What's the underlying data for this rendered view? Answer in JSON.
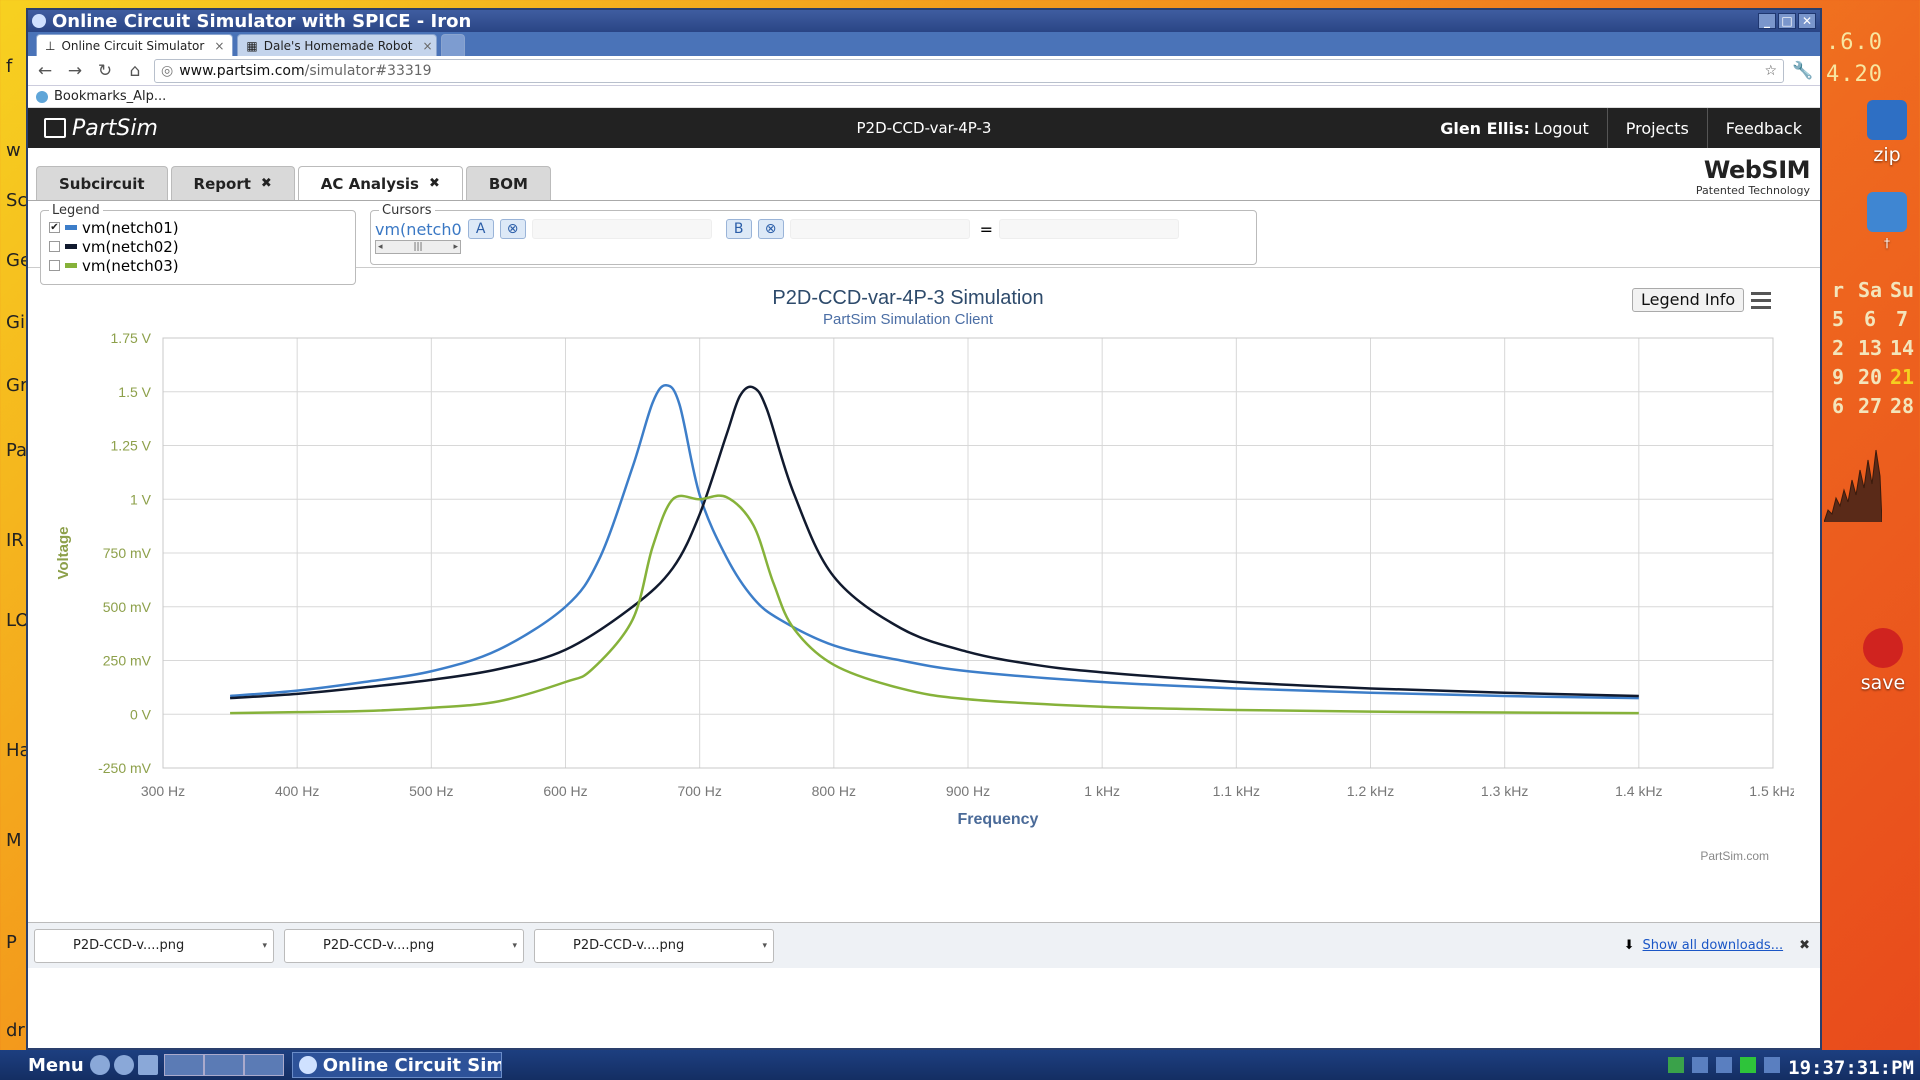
{
  "desktop": {
    "left_labels": [
      "f",
      "w",
      "Sc",
      "Ge",
      "Gi",
      "Gr",
      "Pa",
      "IR",
      "LO",
      "Ha",
      "M",
      "P",
      "dr"
    ],
    "right_version": [
      ".6.0",
      "4.20"
    ],
    "icons": [
      {
        "name": "zip-icon",
        "label": "zip"
      },
      {
        "name": "recycle-bin-icon",
        "label": "†"
      },
      {
        "name": "save-icon",
        "label": "save"
      }
    ],
    "calendar": {
      "header": [
        "r",
        "Sa",
        "Su"
      ],
      "rows": [
        [
          "5",
          "6",
          "7"
        ],
        [
          "2",
          "13",
          "14"
        ],
        [
          "9",
          "20",
          "21"
        ],
        [
          "6",
          "27",
          "28"
        ]
      ],
      "today": "21"
    }
  },
  "window": {
    "title": "Online Circuit Simulator with SPICE - Iron",
    "tabs": [
      {
        "label": "Online Circuit Simulator",
        "active": true
      },
      {
        "label": "Dale's Homemade Robot",
        "active": false
      }
    ],
    "url_host": "www.partsim.com",
    "url_path": "/simulator#33319",
    "bookmarks_label": "Bookmarks_Alp..."
  },
  "app": {
    "logo": "PartSim",
    "project_title": "P2D-CCD-var-4P-3",
    "user_name": "Glen Ellis:",
    "logout": "Logout",
    "projects": "Projects",
    "feedback": "Feedback",
    "websim_brand": "WebSIM",
    "websim_sub": "Patented Technology",
    "subtabs": [
      {
        "label": "Subcircuit",
        "closable": false,
        "active": false
      },
      {
        "label": "Report",
        "closable": true,
        "active": false
      },
      {
        "label": "AC Analysis",
        "closable": true,
        "active": true
      },
      {
        "label": "BOM",
        "closable": false,
        "active": false
      }
    ],
    "legend_title": "Legend",
    "legend_items": [
      {
        "label": "vm(netch01)",
        "checked": true,
        "color": "#3d7ec9"
      },
      {
        "label": "vm(netch02)",
        "checked": false,
        "color": "#111a2e"
      },
      {
        "label": "vm(netch03)",
        "checked": false,
        "color": "#86b23a"
      }
    ],
    "cursors_title": "Cursors",
    "cursor_series": "vm(netch0",
    "cursor_a": "A",
    "cursor_b": "B",
    "cursor_clear": "⊗",
    "equals": "=",
    "legend_info": "Legend Info",
    "credit": "PartSim.com"
  },
  "chart_data": {
    "type": "line",
    "title": "P2D-CCD-var-4P-3 Simulation",
    "subtitle": "PartSim Simulation Client",
    "xlabel": "Frequency",
    "ylabel": "Voltage",
    "xlim": [
      300,
      1500
    ],
    "ylim": [
      -250,
      1750
    ],
    "x_ticks": [
      300,
      400,
      500,
      600,
      700,
      800,
      900,
      1000,
      1100,
      1200,
      1300,
      1400,
      1500
    ],
    "x_tick_labels": [
      "300 Hz",
      "400 Hz",
      "500 Hz",
      "600 Hz",
      "700 Hz",
      "800 Hz",
      "900 Hz",
      "1 kHz",
      "1.1 kHz",
      "1.2 kHz",
      "1.3 kHz",
      "1.4 kHz",
      "1.5 kHz"
    ],
    "y_ticks": [
      1750,
      1500,
      1250,
      1000,
      750,
      500,
      250,
      0,
      -250
    ],
    "y_tick_labels": [
      "1.75 V",
      "1.5 V",
      "1.25 V",
      "1 V",
      "750 mV",
      "500 mV",
      "250 mV",
      "0 V",
      "-250 mV"
    ],
    "grid": true,
    "series": [
      {
        "name": "vm(netch01)",
        "color": "#3d7ec9",
        "x": [
          350,
          400,
          450,
          500,
          550,
          600,
          625,
          650,
          665,
          675,
          685,
          700,
          720,
          740,
          760,
          800,
          850,
          900,
          1000,
          1100,
          1200,
          1300,
          1400
        ],
        "y": [
          85,
          110,
          150,
          200,
          300,
          500,
          720,
          1150,
          1450,
          1530,
          1440,
          1020,
          730,
          540,
          440,
          320,
          250,
          200,
          150,
          120,
          100,
          85,
          75
        ]
      },
      {
        "name": "vm(netch02)",
        "color": "#111a2e",
        "x": [
          350,
          400,
          450,
          500,
          550,
          600,
          650,
          680,
          700,
          720,
          730,
          740,
          750,
          770,
          800,
          850,
          900,
          950,
          1000,
          1100,
          1200,
          1300,
          1400
        ],
        "y": [
          75,
          95,
          125,
          160,
          210,
          300,
          500,
          680,
          930,
          1300,
          1480,
          1520,
          1420,
          1030,
          640,
          400,
          290,
          230,
          195,
          150,
          120,
          100,
          85
        ]
      },
      {
        "name": "vm(netch03)",
        "color": "#86b23a",
        "x": [
          350,
          400,
          450,
          500,
          550,
          600,
          620,
          650,
          665,
          680,
          700,
          720,
          740,
          755,
          770,
          800,
          850,
          900,
          1000,
          1100,
          1200,
          1300,
          1400
        ],
        "y": [
          5,
          10,
          15,
          30,
          60,
          150,
          210,
          440,
          780,
          1000,
          1000,
          1010,
          880,
          610,
          400,
          230,
          120,
          70,
          35,
          20,
          12,
          8,
          5
        ]
      }
    ]
  },
  "downloads": {
    "items": [
      "P2D-CCD-v....png",
      "P2D-CCD-v....png",
      "P2D-CCD-v....png"
    ],
    "show_all": "Show all downloads...",
    "close": "✖"
  },
  "taskbar": {
    "menu": "Menu",
    "task_label": "Online Circuit Simu",
    "clock": "19:37:31:PM"
  }
}
